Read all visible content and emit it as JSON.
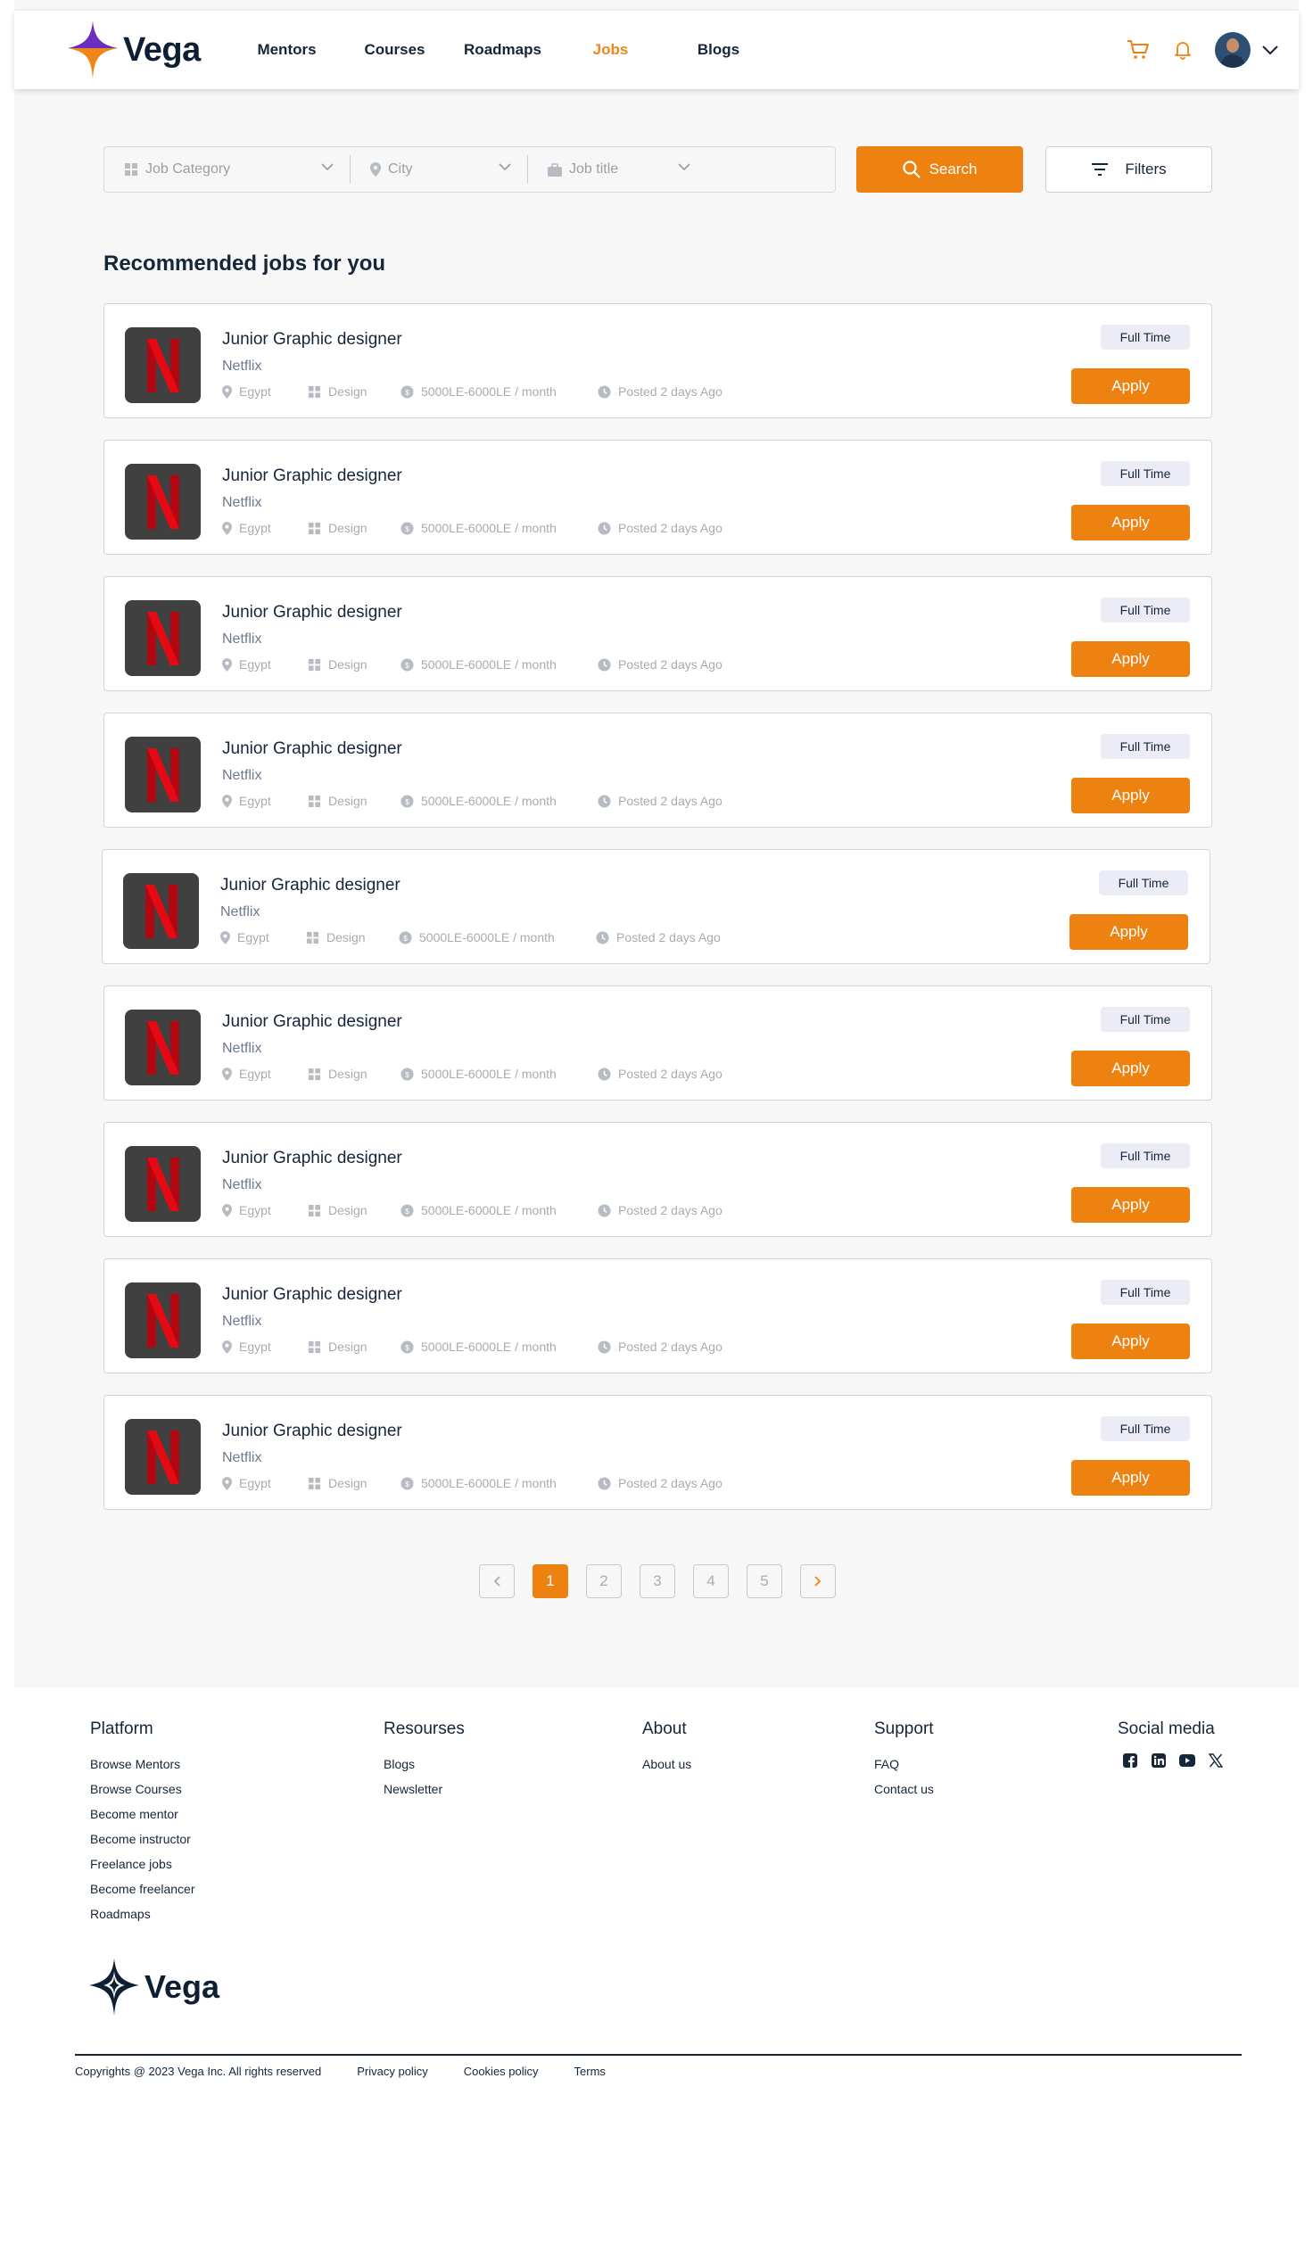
{
  "brand": {
    "name": "Vega",
    "accent": "#ee8211",
    "purple": "#6a2fbf",
    "navy": "#15263a"
  },
  "nav": {
    "links": [
      {
        "label": "Mentors",
        "active": false
      },
      {
        "label": "Courses",
        "active": false
      },
      {
        "label": "Roadmaps",
        "active": false
      },
      {
        "label": "Jobs",
        "active": true
      },
      {
        "label": "Blogs",
        "active": false
      }
    ],
    "icons": [
      "cart-icon",
      "bell-icon",
      "avatar",
      "chevron-down-icon"
    ]
  },
  "search": {
    "category_placeholder": "Job Category",
    "city_placeholder": "City",
    "title_placeholder": "Job title",
    "search_label": "Search",
    "filters_label": "Filters"
  },
  "section_title": "Recommended jobs for you",
  "jobs": [
    {
      "title": "Junior Graphic designer",
      "company": "Netflix",
      "location": "Egypt",
      "category": "Design",
      "salary": "5000LE-6000LE / month",
      "posted": "Posted 2 days Ago",
      "type": "Full Time",
      "apply": "Apply"
    },
    {
      "title": "Junior Graphic designer",
      "company": "Netflix",
      "location": "Egypt",
      "category": "Design",
      "salary": "5000LE-6000LE / month",
      "posted": "Posted 2 days Ago",
      "type": "Full Time",
      "apply": "Apply"
    },
    {
      "title": "Junior Graphic designer",
      "company": "Netflix",
      "location": "Egypt",
      "category": "Design",
      "salary": "5000LE-6000LE / month",
      "posted": "Posted 2 days Ago",
      "type": "Full Time",
      "apply": "Apply"
    },
    {
      "title": "Junior Graphic designer",
      "company": "Netflix",
      "location": "Egypt",
      "category": "Design",
      "salary": "5000LE-6000LE / month",
      "posted": "Posted 2 days Ago",
      "type": "Full Time",
      "apply": "Apply"
    },
    {
      "title": "Junior Graphic designer",
      "company": "Netflix",
      "location": "Egypt",
      "category": "Design",
      "salary": "5000LE-6000LE / month",
      "posted": "Posted 2 days Ago",
      "type": "Full Time",
      "apply": "Apply"
    },
    {
      "title": "Junior Graphic designer",
      "company": "Netflix",
      "location": "Egypt",
      "category": "Design",
      "salary": "5000LE-6000LE / month",
      "posted": "Posted 2 days Ago",
      "type": "Full Time",
      "apply": "Apply"
    },
    {
      "title": "Junior Graphic designer",
      "company": "Netflix",
      "location": "Egypt",
      "category": "Design",
      "salary": "5000LE-6000LE / month",
      "posted": "Posted 2 days Ago",
      "type": "Full Time",
      "apply": "Apply"
    },
    {
      "title": "Junior Graphic designer",
      "company": "Netflix",
      "location": "Egypt",
      "category": "Design",
      "salary": "5000LE-6000LE / month",
      "posted": "Posted 2 days Ago",
      "type": "Full Time",
      "apply": "Apply"
    },
    {
      "title": "Junior Graphic designer",
      "company": "Netflix",
      "location": "Egypt",
      "category": "Design",
      "salary": "5000LE-6000LE / month",
      "posted": "Posted 2 days Ago",
      "type": "Full Time",
      "apply": "Apply"
    }
  ],
  "pagination": {
    "pages": [
      "1",
      "2",
      "3",
      "4",
      "5"
    ],
    "current": "1"
  },
  "footer": {
    "platform": {
      "title": "Platform",
      "links": [
        "Browse Mentors",
        "Browse Courses",
        "Become mentor",
        "Become instructor",
        "Freelance jobs",
        "Become freelancer",
        "Roadmaps"
      ]
    },
    "resources": {
      "title": "Resourses",
      "links": [
        "Blogs",
        "Newsletter"
      ]
    },
    "about": {
      "title": "About",
      "links": [
        "About us"
      ]
    },
    "support": {
      "title": "Support",
      "links": [
        "FAQ",
        "Contact us"
      ]
    },
    "social": {
      "title": "Social media",
      "icons": [
        "facebook-icon",
        "linkedin-icon",
        "youtube-icon",
        "x-icon"
      ]
    },
    "logo_text": "Vega",
    "copyright": "Copyrights @ 2023 Vega Inc. All rights reserved",
    "privacy": "Privacy policy",
    "cookies": "Cookies policy",
    "terms": "Terms"
  }
}
